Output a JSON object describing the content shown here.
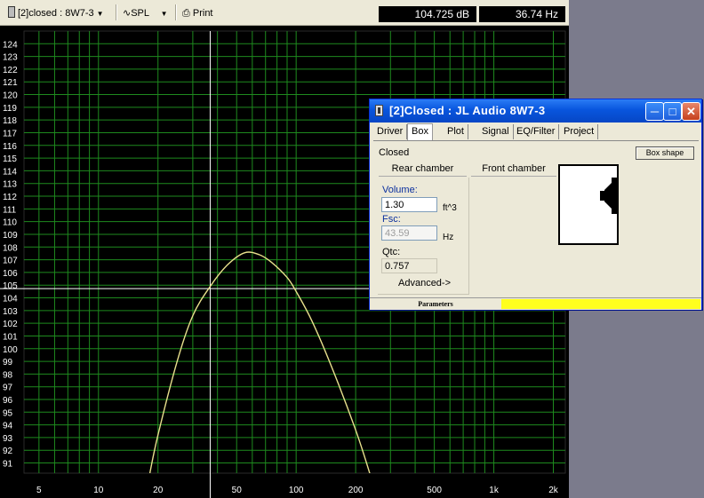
{
  "toolbar": {
    "project_select": "[2]closed : 8W7-3",
    "mode_select": "SPL",
    "print_label": "Print",
    "level_readout": "104.725 dB",
    "freq_readout": "36.74 Hz"
  },
  "chart_data": {
    "type": "line",
    "title": "",
    "xlabel": "",
    "ylabel": "",
    "x_scale": "log",
    "xlim": [
      4.2,
      2300
    ],
    "ylim": [
      90.2,
      125.0
    ],
    "x_tick_labels": [
      "5",
      "10",
      "20",
      "50",
      "100",
      "200",
      "500",
      "1k",
      "2k"
    ],
    "x_tick_values": [
      5,
      10,
      20,
      50,
      100,
      200,
      500,
      1000,
      2000
    ],
    "y_tick_labels": [
      "124",
      "123",
      "122",
      "121",
      "120",
      "119",
      "118",
      "117",
      "116",
      "115",
      "114",
      "113",
      "112",
      "111",
      "110",
      "109",
      "108",
      "107",
      "106",
      "105",
      "104",
      "103",
      "102",
      "101",
      "100",
      "99",
      "98",
      "97",
      "96",
      "95",
      "94",
      "93",
      "92",
      "91"
    ],
    "grid": true,
    "cursor": {
      "x": 36.74,
      "y": 104.725
    },
    "series": [
      {
        "color": "#e8e08c",
        "x": [
          18.2,
          20,
          25,
          30,
          36.74,
          45,
          55,
          65,
          75,
          90,
          100,
          120,
          150,
          200,
          240
        ],
        "y": [
          90.2,
          93.2,
          99.0,
          102.6,
          104.9,
          106.6,
          107.55,
          107.4,
          106.8,
          105.6,
          104.5,
          102.2,
          98.7,
          93.6,
          89.8
        ]
      }
    ],
    "colors": {
      "background": "#000000",
      "grid": "#1e8a1e",
      "axis_text": "#ffffff",
      "cursor": "#ffffff"
    }
  },
  "dialog": {
    "title": "[2]Closed : JL Audio 8W7-3",
    "tabs": [
      "Driver",
      "Box",
      "Plot",
      "Signal",
      "EQ/Filter",
      "Project"
    ],
    "active_tab": "Box",
    "shape_value": "Closed",
    "box_shape_button": "Box shape",
    "rear_chamber_label": "Rear chamber",
    "front_chamber_label": "Front chamber",
    "volume_label": "Volume:",
    "volume_value": "1.30",
    "volume_unit": "ft^3",
    "fsc_label": "Fsc:",
    "fsc_value": "43.59",
    "fsc_unit": "Hz",
    "qtc_label": "Qtc:",
    "qtc_value": "0.757",
    "advanced_label": "Advanced->",
    "status_label": "Parameters",
    "status_color": "#ffff1e"
  }
}
